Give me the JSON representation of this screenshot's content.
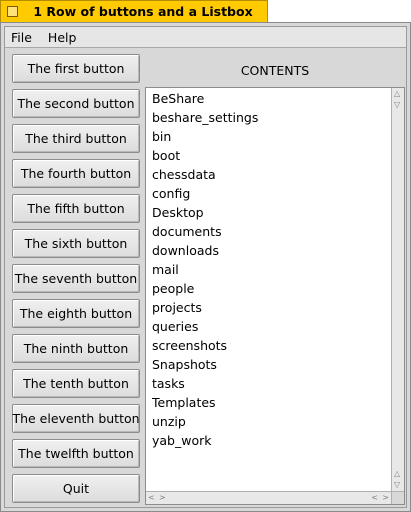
{
  "window": {
    "title": "1 Row of buttons and a Listbox"
  },
  "menubar": {
    "items": [
      "File",
      "Help"
    ]
  },
  "buttons": [
    "The first button",
    "The second button",
    "The third button",
    "The fourth button",
    "The fifth button",
    "The sixth button",
    "The seventh button",
    "The eighth button",
    "The ninth button",
    "The tenth button",
    "The eleventh button",
    "The twelfth button",
    "Quit"
  ],
  "listbox": {
    "label": "CONTENTS",
    "items": [
      "BeShare",
      "beshare_settings",
      "bin",
      "boot",
      "chessdata",
      "config",
      "Desktop",
      "documents",
      "downloads",
      "mail",
      "people",
      "projects",
      "queries",
      "screenshots",
      "Snapshots",
      "tasks",
      "Templates",
      "unzip",
      "yab_work"
    ]
  },
  "colors": {
    "tab": "#ffcb00",
    "window_bg": "#d8d8d8",
    "list_bg": "#ffffff"
  }
}
